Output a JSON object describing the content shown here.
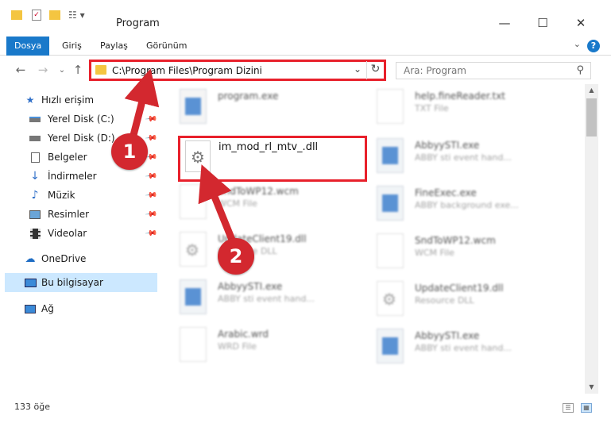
{
  "window": {
    "title": "Program",
    "controls": {
      "minimize": "—",
      "maximize": "☐",
      "close": "✕"
    }
  },
  "ribbon": {
    "tabs": [
      {
        "label": "Dosya",
        "active": true
      },
      {
        "label": "Giriş",
        "active": false
      },
      {
        "label": "Paylaş",
        "active": false
      },
      {
        "label": "Görünüm",
        "active": false
      }
    ],
    "help": "?"
  },
  "address": {
    "path": "C:\\Program Files\\Program Dizini",
    "search_placeholder": "Ara: Program"
  },
  "sidebar": {
    "quick_access": "Hızlı erişim",
    "items": [
      {
        "label": "Yerel Disk (C:)",
        "icon": "drive-icon"
      },
      {
        "label": "Yerel Disk (D:)",
        "icon": "drive-icon"
      },
      {
        "label": "Belgeler",
        "icon": "documents-icon"
      },
      {
        "label": "İndirmeler",
        "icon": "downloads-icon"
      },
      {
        "label": "Müzik",
        "icon": "music-icon"
      },
      {
        "label": "Resimler",
        "icon": "pictures-icon"
      },
      {
        "label": "Videolar",
        "icon": "videos-icon"
      }
    ],
    "onedrive": "OneDrive",
    "this_pc": "Bu bilgisayar",
    "network": "Ağ"
  },
  "files": {
    "highlighted": {
      "name": "im_mod_rl_mtv_.dll"
    },
    "left_column": [
      {
        "name": "program.exe",
        "type": ""
      },
      {
        "name": "im_mod_rl_mtv_.dll",
        "type": ""
      },
      {
        "name": "SndToWP12.wcm",
        "type": "WCM File"
      },
      {
        "name": "UpdateClient19.dll",
        "type": "Resource DLL"
      },
      {
        "name": "AbbyySTI.exe",
        "type": "ABBY sti event hand..."
      },
      {
        "name": "Arabic.wrd",
        "type": "WRD File"
      }
    ],
    "right_column": [
      {
        "name": "help.fineReader.txt",
        "type": "TXT File"
      },
      {
        "name": "AbbyySTI.exe",
        "type": "ABBY sti event hand..."
      },
      {
        "name": "FineExec.exe",
        "type": "ABBY background exe..."
      },
      {
        "name": "SndToWP12.wcm",
        "type": "WCM File"
      },
      {
        "name": "UpdateClient19.dll",
        "type": "Resource DLL"
      },
      {
        "name": "AbbyySTI.exe",
        "type": "ABBY sti event hand..."
      }
    ]
  },
  "status": {
    "count": "133 öğe"
  },
  "steps": [
    "1",
    "2"
  ],
  "colors": {
    "accent": "#1979ca",
    "highlight": "#e8202b",
    "badge": "#d3282f"
  }
}
